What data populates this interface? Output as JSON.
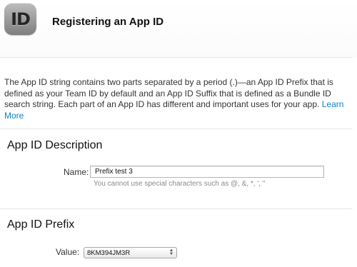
{
  "header": {
    "icon_text": "ID",
    "title": "Registering an App ID"
  },
  "intro": {
    "text": "The App ID string contains two parts separated by a period (.)—an App ID Prefix that is defined as your Team ID by default and an App ID Suffix that is defined as a Bundle ID search string. Each part of an App ID has different and important uses for your app.",
    "link": "Learn More"
  },
  "description_section": {
    "title": "App ID Description",
    "name_label": "Name:",
    "name_value": "Prefix test 3",
    "hint": "You cannot use special characters such as @, &, *, ', \""
  },
  "prefix_section": {
    "title": "App ID Prefix",
    "value_label": "Value:",
    "selected_value": "8KM394JM3R"
  },
  "colors": {
    "link": "#0a82c8",
    "hint": "#8a8a8a",
    "divider": "#e6e6e6"
  },
  "icons": {
    "header_icon": "app-id-icon",
    "select_arrows": "up-down-arrows-icon"
  }
}
